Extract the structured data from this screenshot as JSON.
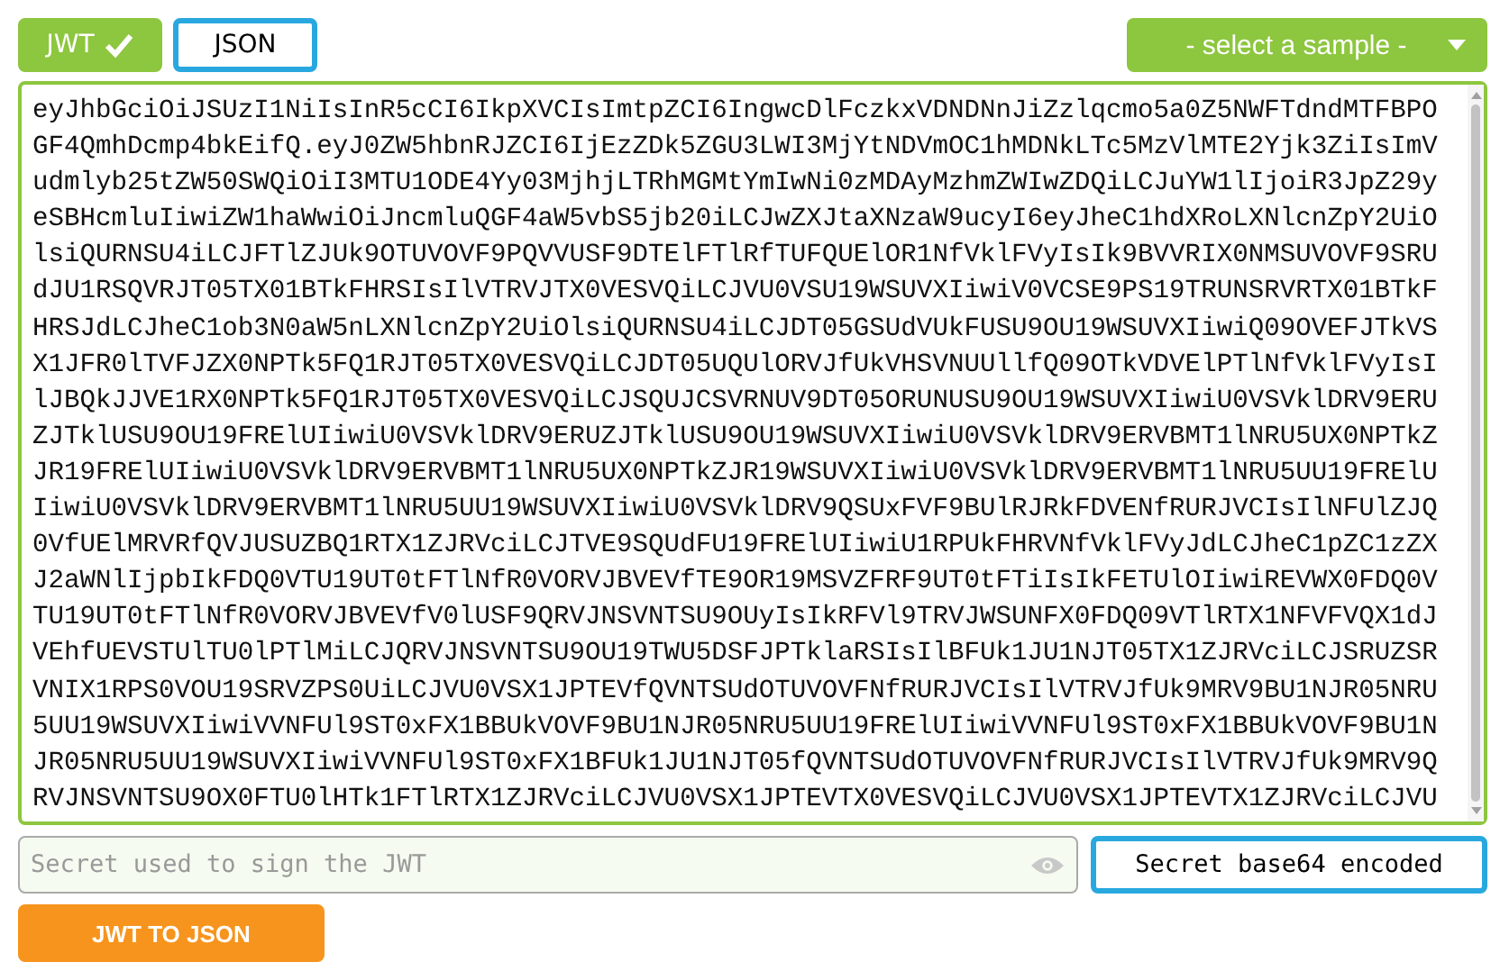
{
  "tabs": [
    {
      "label": "JWT",
      "selected": true,
      "valid": true
    },
    {
      "label": "JSON",
      "selected": false,
      "valid": false
    }
  ],
  "sample_select": {
    "label": "- select a sample -"
  },
  "token_lines": [
    "eyJhbGciOiJSUzI1NiIsInR5cCI6IkpXVCIsImtpZCI6IngwcDlFczkxVDNDNnJiZzlqcmo5a0Z5NWFTdndMTFBPO",
    "GF4QmhDcmp4bkEifQ.eyJ0ZW5hbnRJZCI6IjEzZDk5ZGU3LWI3MjYtNDVmOC1hMDNkLTc5MzVlMTE2Yjk3ZiIsImV",
    "udmlyb25tZW50SWQiOiI3MTU1ODE4Yy03MjhjLTRhMGMtYmIwNi0zMDAyMzhmZWIwZDQiLCJuYW1lIjoiR3JpZ29y",
    "eSBHcmluIiwiZW1haWwiOiJncmluQGF4aW5vbS5jb20iLCJwZXJtaXNzaW9ucyI6eyJheC1hdXRoLXNlcnZpY2UiO",
    "lsiQURNSU4iLCJFTlZJUk9OTUVOVF9PQVVUSF9DTElFTlRfTUFQUElOR1NfVklFVyIsIk9BVVRIX0NMSUVOVF9SRU",
    "dJU1RSQVRJT05TX01BTkFHRSIsIlVTRVJTX0VESVQiLCJVU0VSU19WSUVXIiwiV0VCSE9PS19TRUNSRVRTX01BTkF",
    "HRSJdLCJheC1ob3N0aW5nLXNlcnZpY2UiOlsiQURNSU4iLCJDT05GSUdVUkFUSU9OU19WSUVXIiwiQ09OVEFJTkVS",
    "X1JFR0lTVFJZX0NPTk5FQ1RJT05TX0VESVQiLCJDT05UQUlORVJfUkVHSVNUUllfQ09OTkVDVElPTlNfVklFVyIsI",
    "lJBQkJJVE1RX0NPTk5FQ1RJT05TX0VESVQiLCJSQUJCSVRNUV9DT05ORUNUSU9OU19WSUVXIiwiU0VSVklDRV9ERU",
    "ZJTklUSU9OU19FRElUIiwiU0VSVklDRV9ERUZJTklUSU9OU19WSUVXIiwiU0VSVklDRV9ERVBMT1lNRU5UX0NPTkZ",
    "JR19FRElUIiwiU0VSVklDRV9ERVBMT1lNRU5UX0NPTkZJR19WSUVXIiwiU0VSVklDRV9ERVBMT1lNRU5UU19FRElU",
    "IiwiU0VSVklDRV9ERVBMT1lNRU5UU19WSUVXIiwiU0VSVklDRV9QSUxFVF9BUlRJRkFDVENfRURJVCIsIlNFUlZJQ",
    "0VfUElMRVRfQVJUSUZBQ1RTX1ZJRVciLCJTVE9SQUdFU19FRElUIiwiU1RPUkFHRVNfVklFVyJdLCJheC1pZC1zZX",
    "J2aWNlIjpbIkFDQ0VTU19UT0tFTlNfR0VORVJBVEVfTE9OR19MSVZFRF9UT0tFTiIsIkFETUlOIiwiREVWX0FDQ0V",
    "TU19UT0tFTlNfR0VORVJBVEVfV0lUSF9QRVJNSVNTSU9OUyIsIkRFVl9TRVJWSUNFX0FDQ09VTlRTX1NFVFVQX1dJ",
    "VEhfUEVSTUlTU0lPTlMiLCJQRVJNSVNTSU9OU19TWU5DSFJPTklaRSIsIlBFUk1JU1NJT05TX1ZJRVciLCJSRUZSR",
    "VNIX1RPS0VOU19SRVZPS0UiLCJVU0VSX1JPTEVfQVNTSUdOTUVOVFNfRURJVCIsIlVTRVJfUk9MRV9BU1NJR05NRU",
    "5UU19WSUVXIiwiVVNFUl9ST0xFX1BBUkVOVF9BU1NJR05NRU5UU19FRElUIiwiVVNFUl9ST0xFX1BBUkVOVF9BU1N",
    "JR05NRU5UU19WSUVXIiwiVVNFUl9ST0xFX1BFUk1JU1NJT05fQVNTSUdOTUVOVFNfRURJVCIsIlVTRVJfUk9MRV9Q",
    "RVJNSVNTSU9OX0FTU0lHTk1FTlRTX1ZJRVciLCJVU0VSX1JPTEVTX0VESVQiLCJVU0VSX1JPTEVTX1ZJRVciLCJVU"
  ],
  "secret": {
    "placeholder": "Secret used to sign the JWT"
  },
  "base64_toggle": {
    "label": "Secret base64 encoded",
    "on": false
  },
  "convert_button": {
    "label": "JWT TO JSON"
  }
}
